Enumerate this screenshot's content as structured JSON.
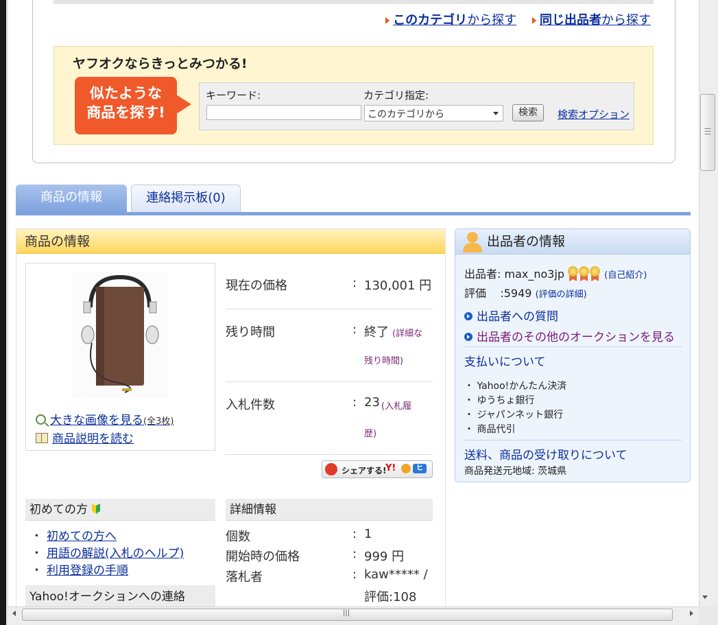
{
  "top_links": {
    "this_category_a": "このカテゴリ",
    "this_category_b": "から探す",
    "same_seller_a": "同じ出品者",
    "same_seller_b": "から探す"
  },
  "find": {
    "title": "ヤフオクならきっとみつかる!",
    "badge_line1": "似たような",
    "badge_line2": "商品を探す!",
    "keyword_label": "キーワード:",
    "keyword_value": "",
    "category_label": "カテゴリ指定:",
    "category_selected": "このカテゴリから",
    "search_button": "検索",
    "search_option": "検索オプション"
  },
  "tabs": [
    {
      "label": "商品の情報"
    },
    {
      "label": "連絡掲示板(0)"
    }
  ],
  "product": {
    "header": "商品の情報",
    "big_image_link": "大きな画像を見る",
    "big_image_count": "(全3枚)",
    "description_link": "商品説明を読む",
    "rows": [
      {
        "label": "現在の価格",
        "colon": ":",
        "value": "130,001 円",
        "extra": ""
      },
      {
        "label": "残り時間",
        "colon": ":",
        "value": "終了",
        "extra": "(詳細な",
        "extra2": "残り時間)"
      },
      {
        "label": "入札件数",
        "colon": ":",
        "value": "23",
        "extra": "(入札履",
        "extra2": "歴)"
      }
    ],
    "share_text": "シェアする!",
    "share_y": "Y!",
    "share_h": "ヒ"
  },
  "beginner": {
    "header": "初めての方",
    "links": [
      "初めての方へ",
      "用語の解説(入札のヘルプ)",
      "利用登録の手順"
    ],
    "contact_header": "Yahoo!オークションへの連絡"
  },
  "details": {
    "header": "詳細情報",
    "rows": [
      {
        "label": "個数",
        "colon": ":",
        "value": "1"
      },
      {
        "label": "開始時の価格",
        "colon": ":",
        "value": "999 円"
      },
      {
        "label": "落札者",
        "colon": ":",
        "value": "kaw***** /",
        "value2": "評価:108"
      }
    ]
  },
  "seller": {
    "header": "出品者の情報",
    "seller_label": "出品者:",
    "seller_id": "max_no3jp",
    "self_intro": "(自己紹介)",
    "rating_label": "評価",
    "rating_colon": ":",
    "rating_value": "5949",
    "rating_detail": "(評価の詳細)",
    "question_link": "出品者への質問",
    "other_auctions_link": "出品者のその他のオークションを見る",
    "payment_header": "支払いについて",
    "payment_methods": [
      "Yahoo!かんたん決済",
      "ゆうちょ銀行",
      "ジャパンネット銀行",
      "商品代引"
    ],
    "shipping_header": "送料、商品の受け取りについて",
    "ship_from_label": "商品発送元地域:",
    "ship_from_value": "茨城県"
  },
  "colors": {
    "link": "#0b2f9c",
    "tab_active": "#7fa3de",
    "header_yellow": "#ffd65a",
    "badge_orange": "#f0592a"
  }
}
